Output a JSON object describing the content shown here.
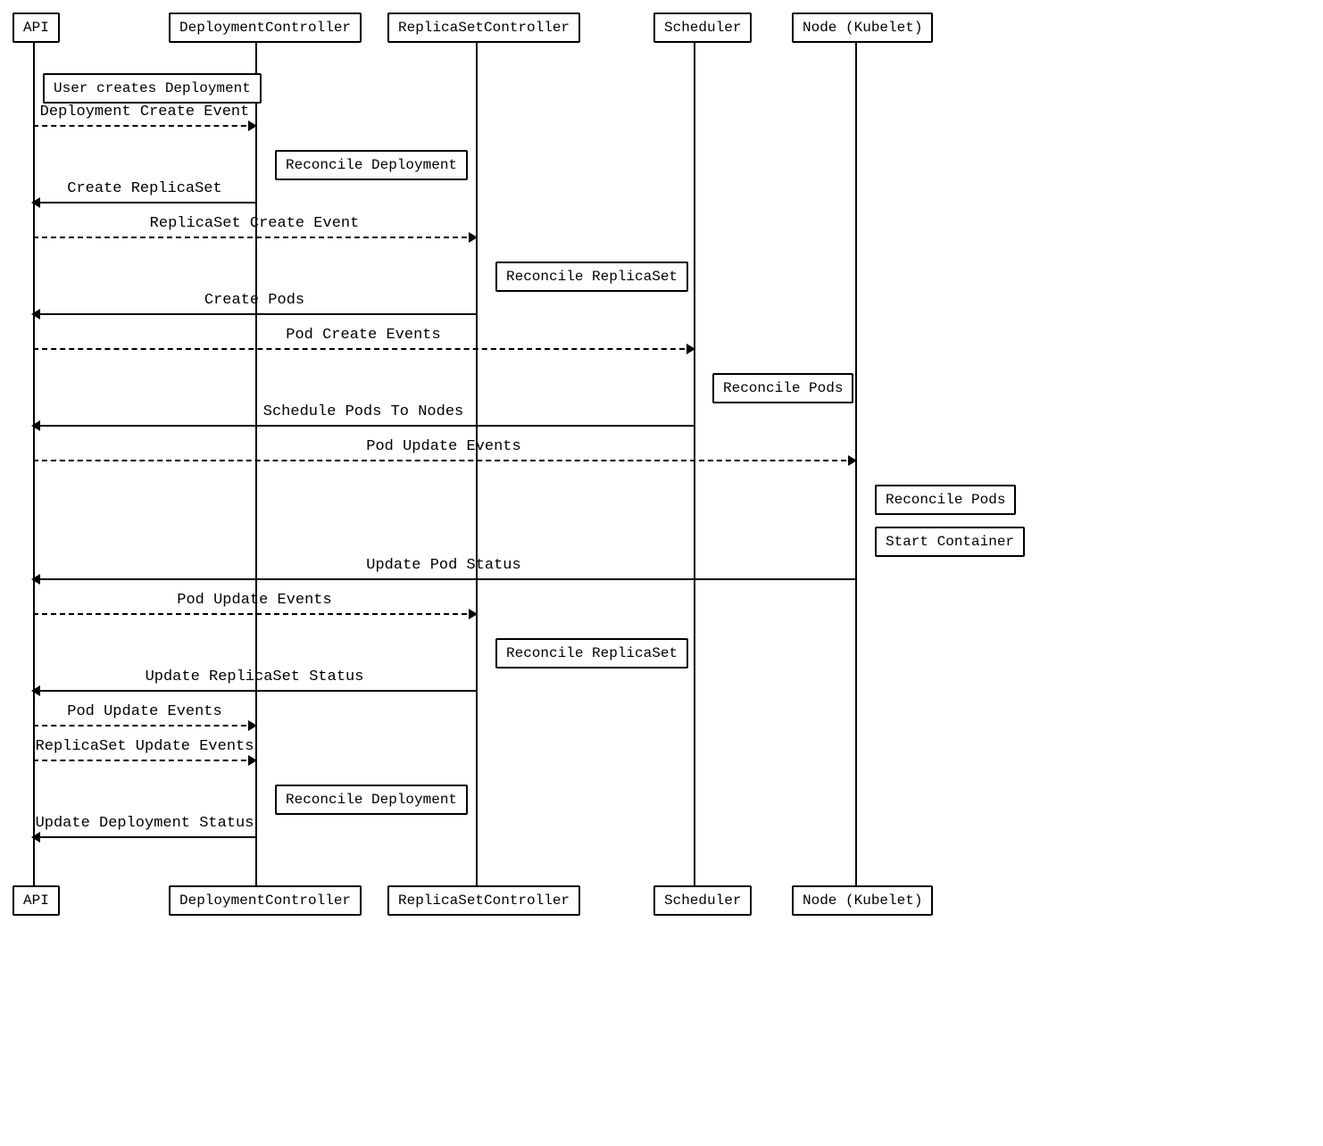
{
  "participants": {
    "api": "API",
    "dc": "DeploymentController",
    "rsc": "ReplicaSetController",
    "sched": "Scheduler",
    "node": "Node (Kubelet)"
  },
  "notes": {
    "user_creates_deployment": "User creates Deployment",
    "reconcile_deployment_1": "Reconcile Deployment",
    "reconcile_replicaset_1": "Reconcile ReplicaSet",
    "reconcile_pods_sched": "Reconcile Pods",
    "reconcile_pods_node": "Reconcile Pods",
    "start_container": "Start Container",
    "reconcile_replicaset_2": "Reconcile ReplicaSet",
    "reconcile_deployment_2": "Reconcile Deployment"
  },
  "messages": {
    "m1": "Deployment Create Event",
    "m2": "Create ReplicaSet",
    "m3": "ReplicaSet Create Event",
    "m4": "Create Pods",
    "m5": "Pod Create Events",
    "m6": "Schedule Pods To Nodes",
    "m7": "Pod Update Events",
    "m8": "Update Pod Status",
    "m9": "Pod Update Events",
    "m10": "Update ReplicaSet Status",
    "m11": "Pod Update Events",
    "m12": "ReplicaSet Update Events",
    "m13": "Update Deployment Status"
  }
}
